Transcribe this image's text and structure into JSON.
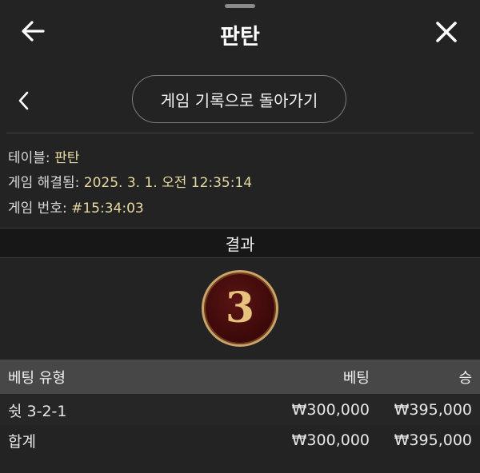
{
  "header": {
    "title": "판탄"
  },
  "nav": {
    "back_label": "게임 기록으로 돌아가기"
  },
  "info": {
    "table_label": "테이블:",
    "table_value": "판탄",
    "resolved_label": "게임 해결됨:",
    "resolved_value": "2025. 3. 1. 오전 12:35:14",
    "number_label": "게임 번호:",
    "number_value": "#15:34:03"
  },
  "result": {
    "heading": "결과",
    "value": "3"
  },
  "bets": {
    "columns": [
      "베팅 유형",
      "베팅",
      "승"
    ],
    "rows": [
      {
        "type": "쉿 3-2-1",
        "bet": "₩300,000",
        "win": "₩395,000"
      }
    ],
    "total": {
      "label": "합계",
      "bet": "₩300,000",
      "win": "₩395,000"
    }
  },
  "colors": {
    "background": "#232323",
    "accent_gold": "#c9a46a",
    "ball_red": "#4a0f0f",
    "header_row": "#474747"
  }
}
